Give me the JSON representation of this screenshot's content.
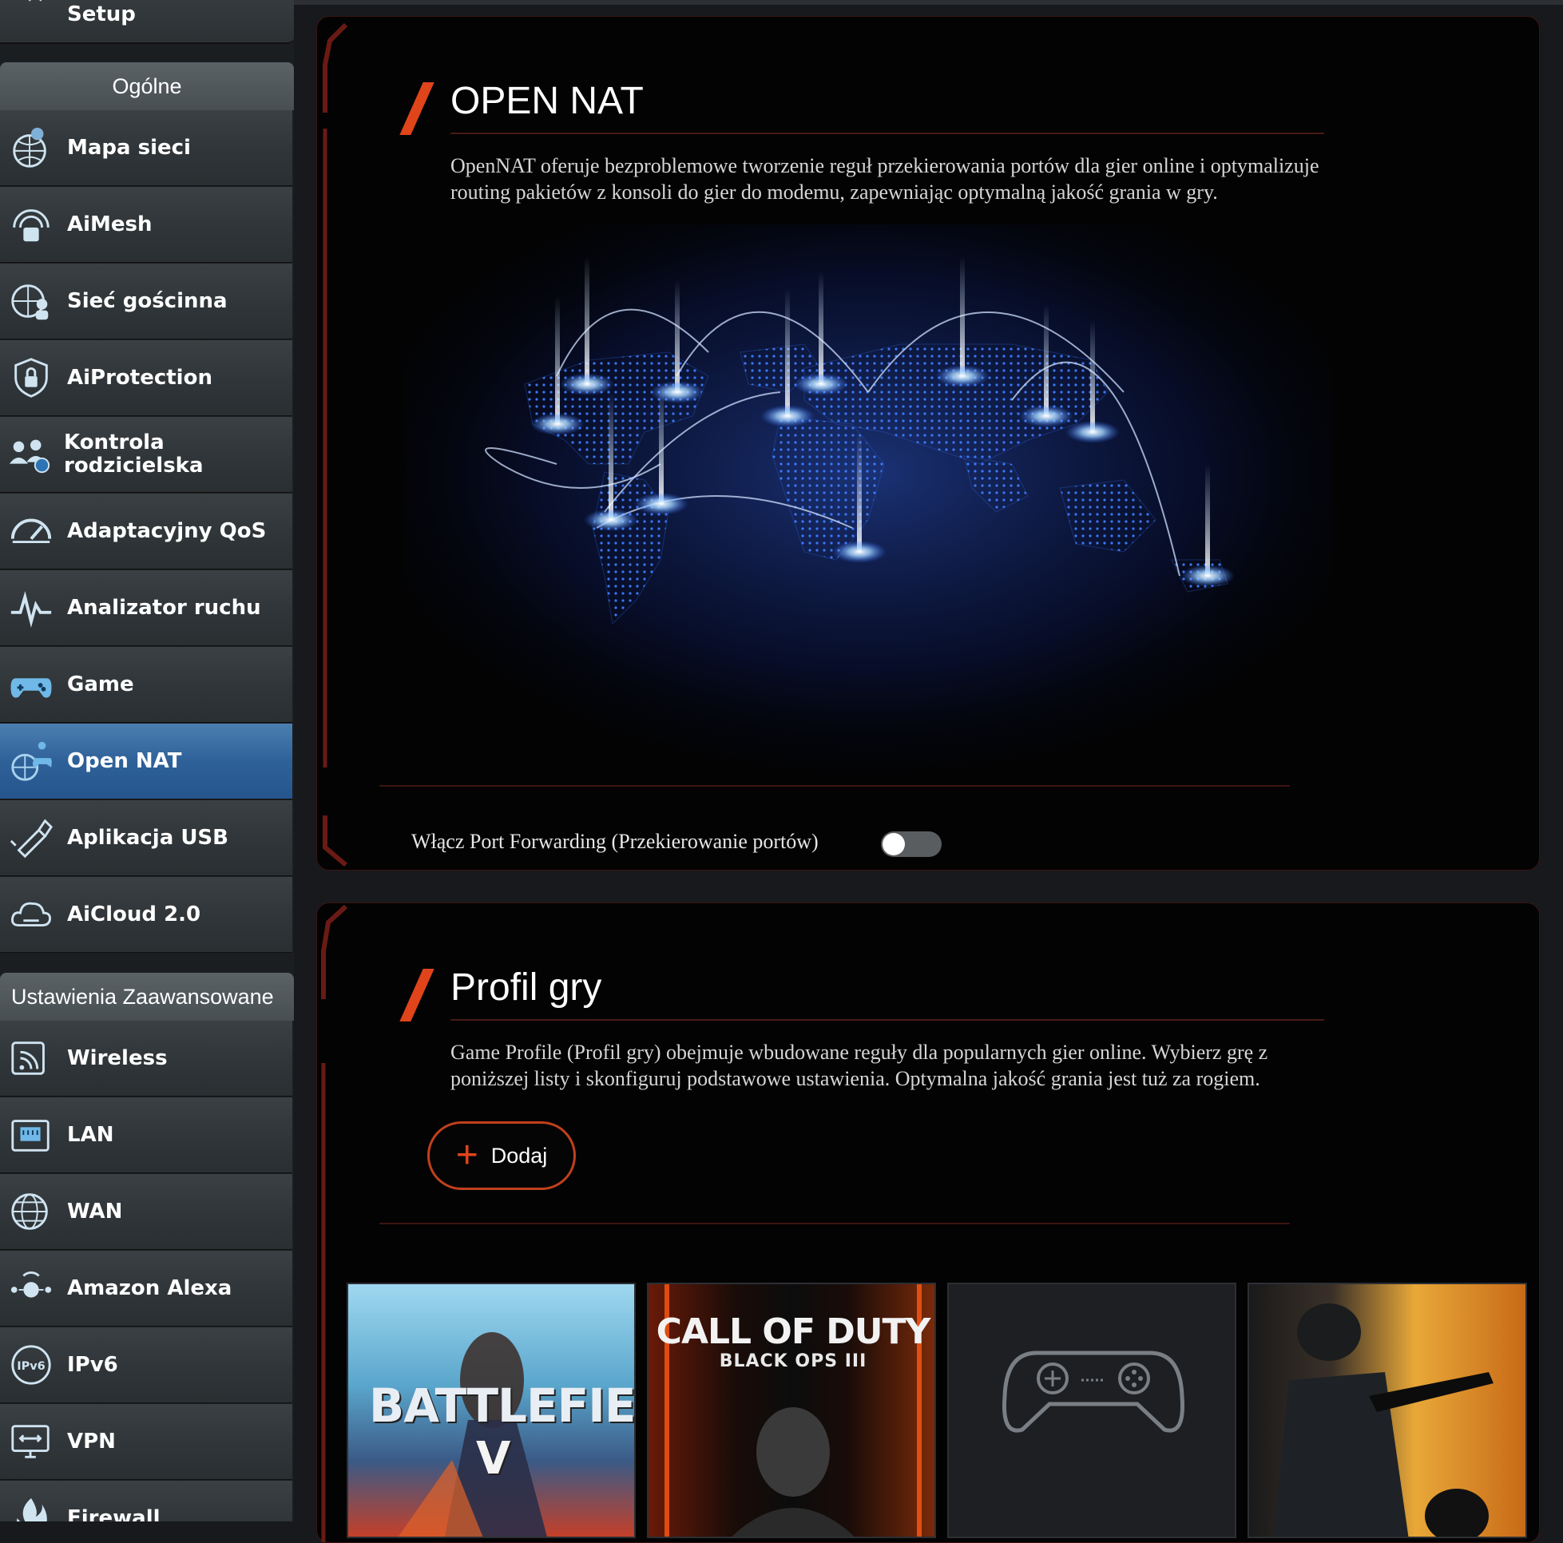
{
  "sidebar": {
    "setup_label": "Setup",
    "general_header": "Ogólne",
    "general_items": [
      {
        "label": "Mapa sieci",
        "icon": "network-map-icon"
      },
      {
        "label": "AiMesh",
        "icon": "aimesh-icon"
      },
      {
        "label": "Sieć gościnna",
        "icon": "guest-network-icon"
      },
      {
        "label": "AiProtection",
        "icon": "shield-lock-icon"
      },
      {
        "label": "Kontrola rodzicielska",
        "icon": "parental-control-icon"
      },
      {
        "label": "Adaptacyjny QoS",
        "icon": "speedometer-icon"
      },
      {
        "label": "Analizator ruchu",
        "icon": "traffic-analyzer-icon"
      },
      {
        "label": "Game",
        "icon": "gamepad-icon"
      },
      {
        "label": "Open NAT",
        "icon": "open-nat-icon",
        "active": true
      },
      {
        "label": "Aplikacja USB",
        "icon": "usb-icon"
      },
      {
        "label": "AiCloud 2.0",
        "icon": "cloud-icon"
      }
    ],
    "advanced_header": "Ustawienia Zaawansowane",
    "advanced_items": [
      {
        "label": "Wireless",
        "icon": "wireless-icon"
      },
      {
        "label": "LAN",
        "icon": "lan-icon"
      },
      {
        "label": "WAN",
        "icon": "globe-icon"
      },
      {
        "label": "Amazon Alexa",
        "icon": "alexa-icon"
      },
      {
        "label": "IPv6",
        "icon": "ipv6-icon"
      },
      {
        "label": "VPN",
        "icon": "vpn-icon"
      },
      {
        "label": "Firewall",
        "icon": "firewall-icon"
      }
    ]
  },
  "open_nat": {
    "title": "OPEN NAT",
    "description": "OpenNAT oferuje bezproblemowe tworzenie reguł przekierowania portów dla gier online i optymalizuje routing pakietów z konsoli do gier do modemu, zapewniając optymalną jakość grania w gry.",
    "port_forwarding_label": "Włącz Port Forwarding (Przekierowanie portów)",
    "port_forwarding_enabled": false
  },
  "game_profile": {
    "title": "Profil gry",
    "description": "Game Profile (Profil gry) obejmuje wbudowane reguły dla popularnych gier online. Wybierz grę z poniższej listy i skonfiguruj podstawowe ustawienia. Optymalna jakość grania jest tuż za rogiem.",
    "add_button_label": "Dodaj",
    "games": [
      {
        "title_line1": "BATTLEFIELD",
        "title_line2": "V"
      },
      {
        "title_line1": "CALL OF DUTY",
        "title_line2": "BLACK OPS III"
      },
      {
        "title_line1": "",
        "title_line2": "",
        "icon": "gamepad-icon"
      },
      {
        "title_line1": "",
        "title_line2": ""
      }
    ]
  },
  "colors": {
    "accent": "#e0441b",
    "active_nav": "#2f6199",
    "card_bg": "#030303"
  }
}
